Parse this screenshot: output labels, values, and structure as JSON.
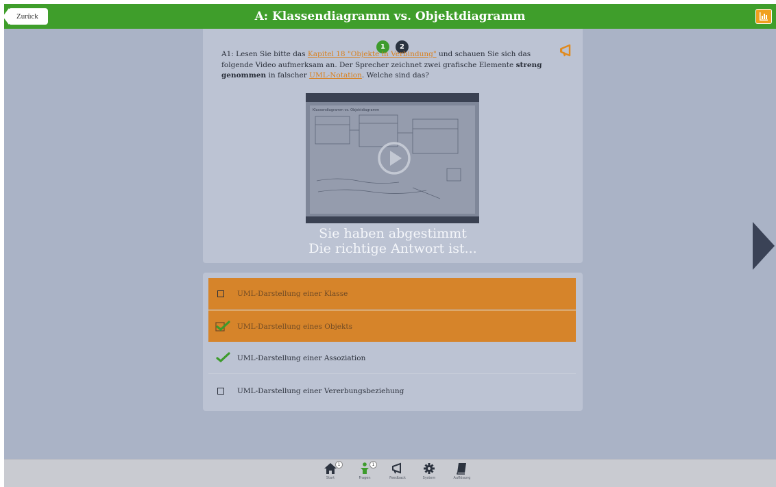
{
  "header": {
    "back_label": "Zurück",
    "title": "A: Klassendiagramm vs. Objektdiagramm",
    "stats_icon": "bar-chart-icon"
  },
  "question": {
    "steps": [
      "1",
      "2"
    ],
    "prefix": "A1: Lesen Sie bitte das ",
    "link1": "Kapitel 18 \"Objekte in Verbindung\"",
    "mid": " und schauen Sie sich das folgende Video aufmerksam an. Der Sprecher zeichnet zwei grafische Elemente ",
    "bold": "streng genommen",
    "mid2": " in falscher ",
    "link2": "UML-Notation",
    "suffix": ". Welche sind das?",
    "video_caption": "Klassendiagramm vs. Objektdiagramm",
    "voted_line1": "Sie haben abgestimmt",
    "voted_line2": "Die richtige Antwort ist..."
  },
  "answers": [
    {
      "label": "UML-Darstellung einer Klasse",
      "highlighted": true,
      "checked": false
    },
    {
      "label": "UML-Darstellung eines Objekts",
      "highlighted": true,
      "checked": true
    },
    {
      "label": "UML-Darstellung einer Assoziation",
      "highlighted": false,
      "checked": true
    },
    {
      "label": "UML-Darstellung einer Vererbungsbeziehung",
      "highlighted": false,
      "checked": false
    }
  ],
  "nav": {
    "start": {
      "label": "Start",
      "badge": "1"
    },
    "fragen": {
      "label": "Fragen",
      "badge": "1"
    },
    "feedback": {
      "label": "Feedback"
    },
    "system": {
      "label": "System"
    },
    "auflosung": {
      "label": "Auflösung"
    }
  },
  "colors": {
    "header_green": "#3f9e2b",
    "accent_orange": "#d6842a",
    "check_green": "#3d9b2c"
  }
}
